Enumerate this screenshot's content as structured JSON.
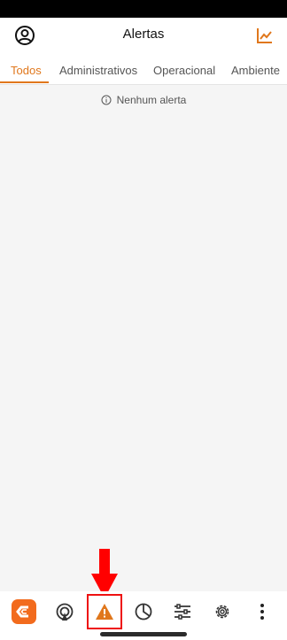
{
  "header": {
    "title": "Alertas",
    "account_icon": "account-circle-icon",
    "analytics_icon": "trend-chart-icon",
    "accent": "#e0771c"
  },
  "tabs": [
    {
      "label": "Todos",
      "active": true
    },
    {
      "label": "Administrativos",
      "active": false
    },
    {
      "label": "Operacional",
      "active": false
    },
    {
      "label": "Ambiente",
      "active": false
    }
  ],
  "empty_state": {
    "icon": "info-icon",
    "text": "Nenhum alerta"
  },
  "bottom_nav": [
    {
      "icon": "app-logo-icon",
      "selected": false
    },
    {
      "icon": "antenna-icon",
      "selected": false
    },
    {
      "icon": "warning-icon",
      "selected": true
    },
    {
      "icon": "pie-chart-icon",
      "selected": false
    },
    {
      "icon": "sliders-icon",
      "selected": false
    },
    {
      "icon": "gear-icon",
      "selected": false
    },
    {
      "icon": "more-vertical-icon",
      "selected": false
    }
  ],
  "colors": {
    "highlight": "#e11111",
    "warning": "#e0771c"
  }
}
